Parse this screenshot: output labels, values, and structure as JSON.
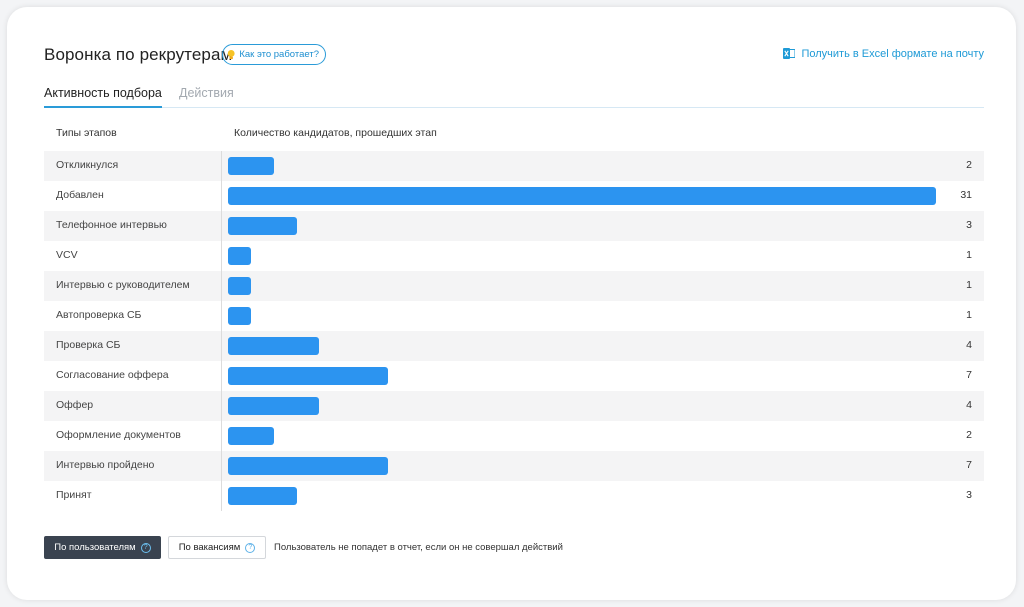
{
  "header": {
    "title": "Воронка по рекрутерам",
    "howto_label": "Как это работает?",
    "excel_link": "Получить в Excel формате на почту"
  },
  "tabs": [
    {
      "label": "Активность подбора",
      "active": true
    },
    {
      "label": "Действия",
      "active": false
    }
  ],
  "columns": {
    "left": "Типы этапов",
    "right": "Количество кандидатов, прошедших этап"
  },
  "chart_data": {
    "type": "bar",
    "orientation": "horizontal",
    "categories": [
      "Откликнулся",
      "Добавлен",
      "Телефонное интервью",
      "VCV",
      "Интервью с руководителем",
      "Автопроверка СБ",
      "Проверка СБ",
      "Согласование оффера",
      "Оффер",
      "Оформление документов",
      "Интервью пройдено",
      "Принят"
    ],
    "values": [
      2,
      31,
      3,
      1,
      1,
      1,
      4,
      7,
      4,
      2,
      7,
      3
    ],
    "xlim": [
      0,
      31
    ],
    "bar_color": "#2c94f0"
  },
  "footer": {
    "by_users": "По пользователям",
    "by_vacancies": "По вакансиям",
    "note": "Пользователь не попадет в отчет, если он не совершал действий"
  },
  "colors": {
    "accent": "#2a9bd8",
    "dark_button": "#3a4350"
  }
}
